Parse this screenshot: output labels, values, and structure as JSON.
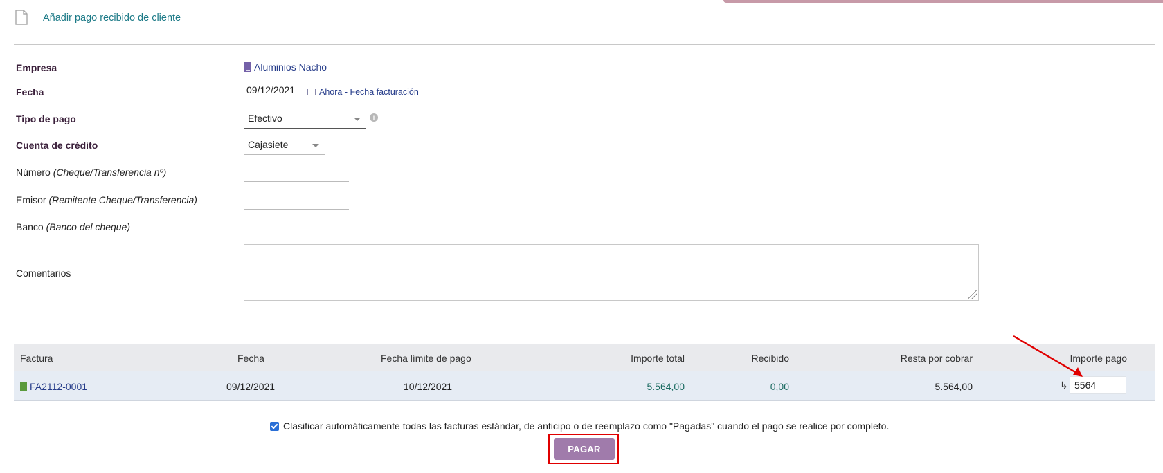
{
  "header": {
    "title": "Añadir pago recibido de cliente",
    "icon": "document-icon"
  },
  "form": {
    "empresa_label": "Empresa",
    "empresa_value": "Aluminios Nacho",
    "fecha_label": "Fecha",
    "fecha_value": "09/12/2021",
    "fecha_now_link": "Ahora - Fecha facturación",
    "tipo_pago_label": "Tipo de pago",
    "tipo_pago_value": "Efectivo",
    "cuenta_label": "Cuenta de crédito",
    "cuenta_value": "Cajasiete",
    "numero_label": "Número",
    "numero_hint": "(Cheque/Transferencia nº)",
    "emisor_label": "Emisor",
    "emisor_hint": "(Remitente Cheque/Transferencia)",
    "banco_label": "Banco",
    "banco_hint": "(Banco del cheque)",
    "comentarios_label": "Comentarios"
  },
  "table": {
    "headers": {
      "factura": "Factura",
      "fecha": "Fecha",
      "fecha_limite": "Fecha límite de pago",
      "importe_total": "Importe total",
      "recibido": "Recibido",
      "resta": "Resta por cobrar",
      "importe_pago": "Importe pago"
    },
    "row": {
      "factura": "FA2112-0001",
      "fecha": "09/12/2021",
      "fecha_limite": "10/12/2021",
      "importe_total": "5.564,00",
      "recibido": "0,00",
      "resta": "5.564,00",
      "transfer_symbol": "↳",
      "importe_pago": "5564"
    }
  },
  "footer": {
    "checkbox_text": "Clasificar automáticamente todas las facturas estándar, de anticipo o de reemplazo como \"Pagadas\" cuando el pago se realice por completo.",
    "checkbox_checked": true,
    "pay_button": "PAGAR"
  },
  "colors": {
    "accent": "#a07bab",
    "link": "#263c8a",
    "title": "#1c7a87",
    "highlight": "#e00000"
  }
}
